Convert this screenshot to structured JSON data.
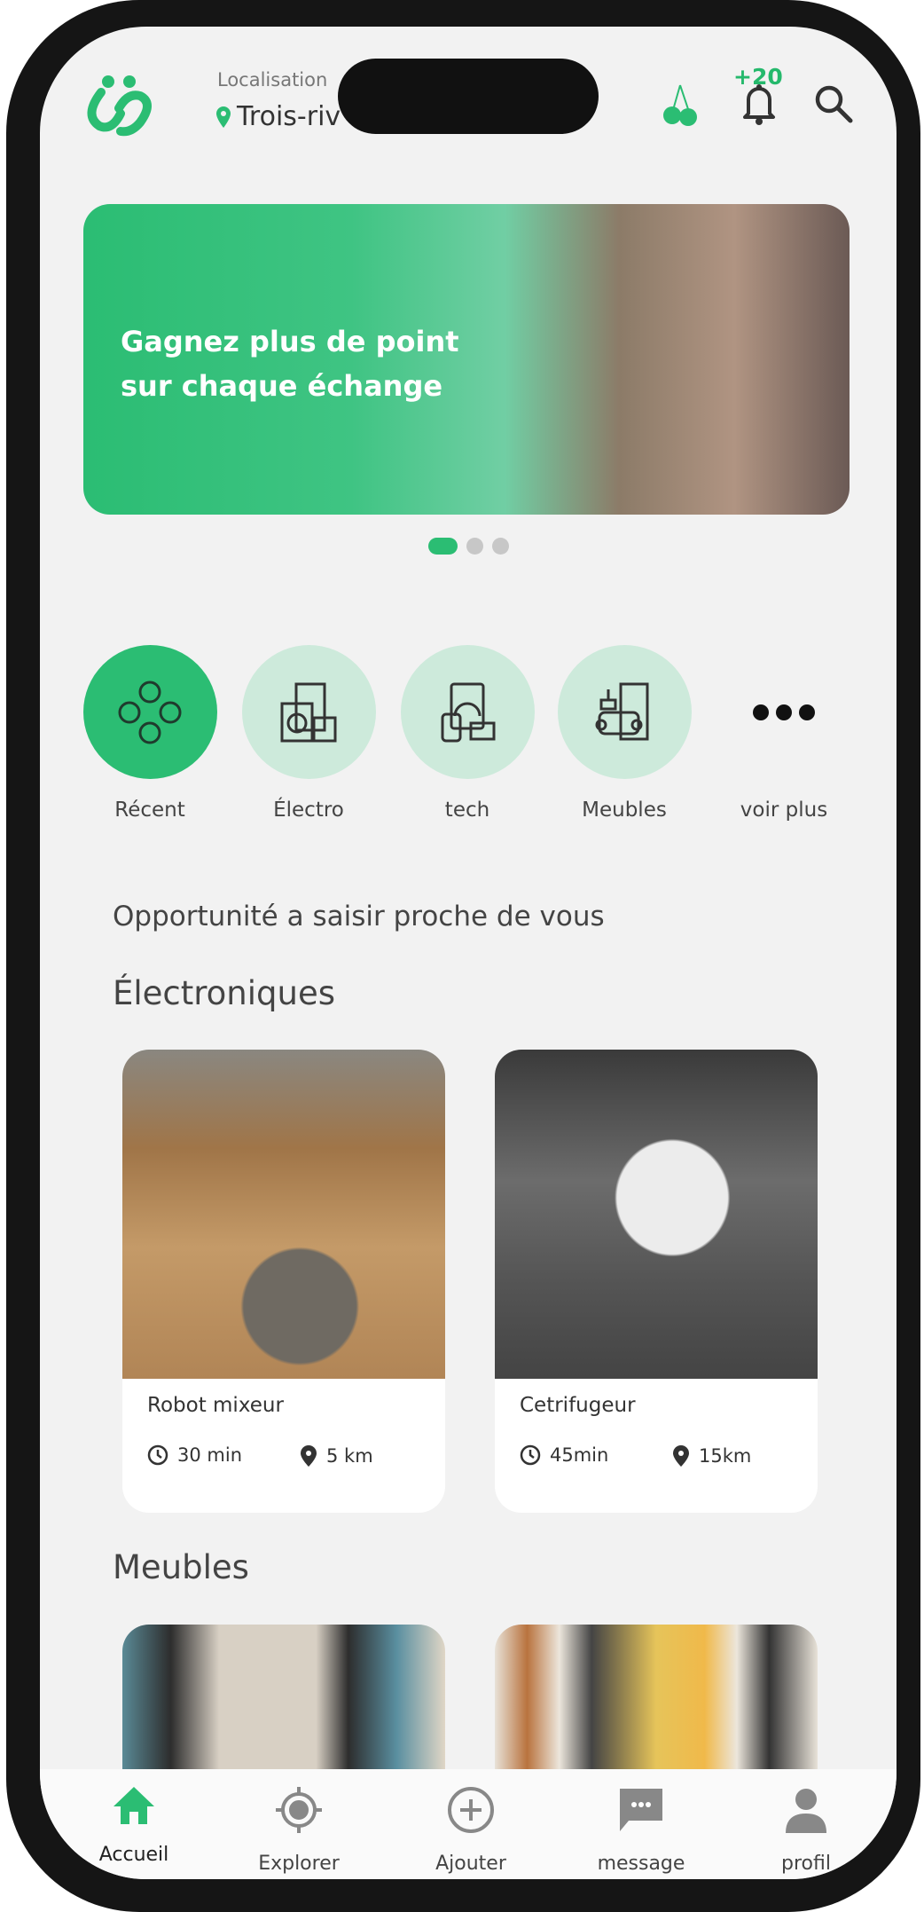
{
  "header": {
    "location_label": "Localisation",
    "location_value": "Trois-riv",
    "points": "+20"
  },
  "banner": {
    "text": "Gagnez plus de point sur chaque échange",
    "slides": 3,
    "active_slide": 1
  },
  "categories": [
    {
      "label": "Récent",
      "icon": "dots-grid-icon",
      "active": true
    },
    {
      "label": "Électro",
      "icon": "appliances-icon"
    },
    {
      "label": "tech",
      "icon": "tech-devices-icon"
    },
    {
      "label": "Meubles",
      "icon": "furniture-icon"
    },
    {
      "label": "voir plus",
      "icon": "more-icon"
    }
  ],
  "section_title": "Opportunité a saisir proche de vous",
  "sections": [
    {
      "title": "Électroniques",
      "items": [
        {
          "title": "Robot mixeur",
          "time": "30 min",
          "distance": "5 km"
        },
        {
          "title": "Cetrifugeur",
          "time": "45min",
          "distance": "15km"
        }
      ]
    },
    {
      "title": "Meubles",
      "items": []
    }
  ],
  "nav": [
    {
      "label": "Accueil",
      "active": true
    },
    {
      "label": "Explorer"
    },
    {
      "label": "Ajouter"
    },
    {
      "label": "message"
    },
    {
      "label": "profil"
    }
  ],
  "colors": {
    "accent": "#2bbd73",
    "accent_light": "#cdeadb"
  }
}
